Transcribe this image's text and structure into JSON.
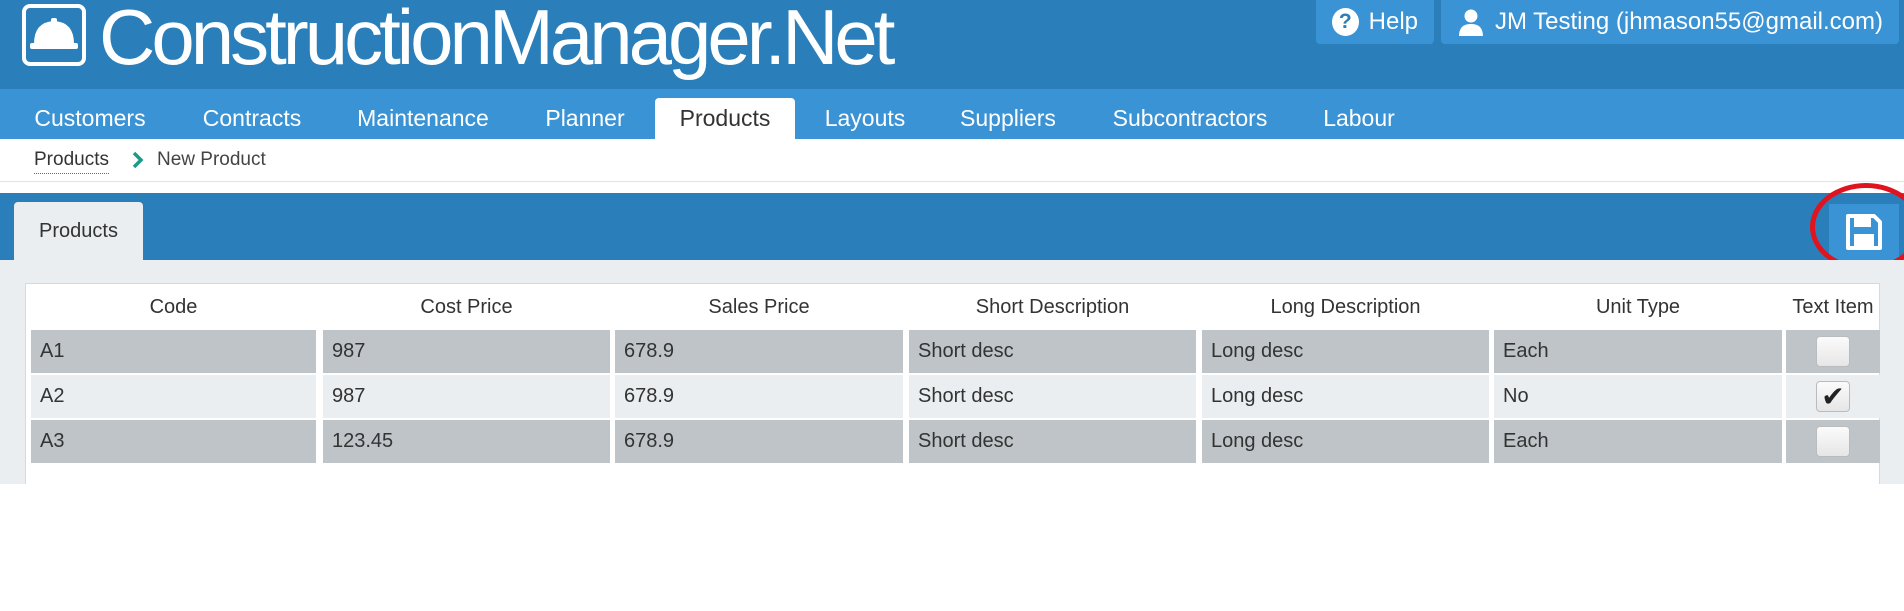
{
  "header": {
    "app_title": "ConstructionManager.Net",
    "help_label": "Help",
    "user_label": "JM Testing (jhmason55@gmail.com)"
  },
  "nav": {
    "items": [
      {
        "label": "Customers",
        "active": false
      },
      {
        "label": "Contracts",
        "active": false
      },
      {
        "label": "Maintenance",
        "active": false
      },
      {
        "label": "Planner",
        "active": false
      },
      {
        "label": "Products",
        "active": true
      },
      {
        "label": "Layouts",
        "active": false
      },
      {
        "label": "Suppliers",
        "active": false
      },
      {
        "label": "Subcontractors",
        "active": false
      },
      {
        "label": "Labour",
        "active": false
      }
    ]
  },
  "breadcrumb": {
    "parent": "Products",
    "current": "New Product"
  },
  "panel": {
    "tab_label": "Products",
    "save_icon": "floppy-disk-icon"
  },
  "table": {
    "columns": [
      "Code",
      "Cost Price",
      "Sales Price",
      "Short Description",
      "Long Description",
      "Unit Type",
      "Text Item"
    ],
    "rows": [
      {
        "code": "A1",
        "cost_price": "987",
        "sales_price": "678.9",
        "short_desc": "Short desc",
        "long_desc": "Long desc",
        "unit_type": "Each",
        "text_item": false
      },
      {
        "code": "A2",
        "cost_price": "987",
        "sales_price": "678.9",
        "short_desc": "Short desc",
        "long_desc": "Long desc",
        "unit_type": "No",
        "text_item": true
      },
      {
        "code": "A3",
        "cost_price": "123.45",
        "sales_price": "678.9",
        "short_desc": "Short desc",
        "long_desc": "Long desc",
        "unit_type": "Each",
        "text_item": false
      }
    ]
  },
  "colors": {
    "header_blue": "#2a7fba",
    "nav_blue": "#3a93d4",
    "highlight_red": "#e0141e",
    "row_dark": "#bec4c7",
    "row_light": "#eaeef0"
  }
}
